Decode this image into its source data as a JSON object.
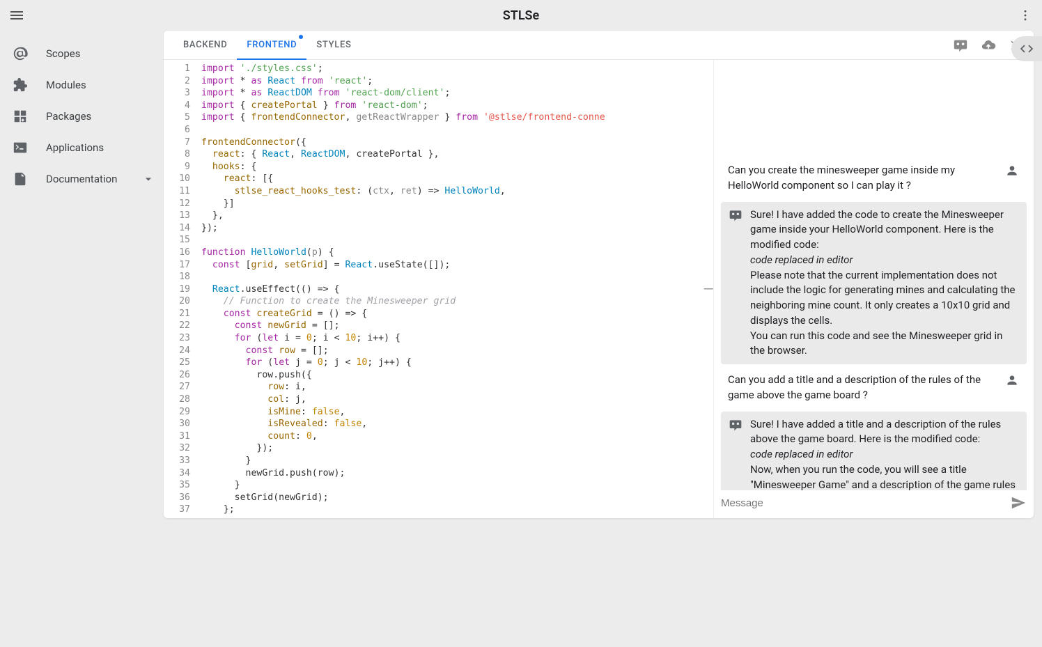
{
  "app": {
    "title": "STLSe"
  },
  "sidebar": {
    "items": [
      {
        "label": "Scopes"
      },
      {
        "label": "Modules"
      },
      {
        "label": "Packages"
      },
      {
        "label": "Applications"
      },
      {
        "label": "Documentation"
      }
    ]
  },
  "tabs": [
    {
      "label": "BACKEND"
    },
    {
      "label": "FRONTEND"
    },
    {
      "label": "STYLES"
    }
  ],
  "active_tab": 1,
  "editor": {
    "line_start": 1,
    "line_end": 37
  },
  "code_lines": [
    [
      {
        "t": "kw",
        "v": "import"
      },
      {
        "t": "",
        "v": " "
      },
      {
        "t": "str",
        "v": "'./styles.css'"
      },
      {
        "t": "",
        "v": ";"
      }
    ],
    [
      {
        "t": "kw",
        "v": "import"
      },
      {
        "t": "",
        "v": " * "
      },
      {
        "t": "kw",
        "v": "as"
      },
      {
        "t": "",
        "v": " "
      },
      {
        "t": "fn",
        "v": "React"
      },
      {
        "t": "",
        "v": " "
      },
      {
        "t": "kw",
        "v": "from"
      },
      {
        "t": "",
        "v": " "
      },
      {
        "t": "str",
        "v": "'react'"
      },
      {
        "t": "",
        "v": ";"
      }
    ],
    [
      {
        "t": "kw",
        "v": "import"
      },
      {
        "t": "",
        "v": " * "
      },
      {
        "t": "kw",
        "v": "as"
      },
      {
        "t": "",
        "v": " "
      },
      {
        "t": "fn",
        "v": "ReactDOM"
      },
      {
        "t": "",
        "v": " "
      },
      {
        "t": "kw",
        "v": "from"
      },
      {
        "t": "",
        "v": " "
      },
      {
        "t": "str",
        "v": "'react-dom/client'"
      },
      {
        "t": "",
        "v": ";"
      }
    ],
    [
      {
        "t": "kw",
        "v": "import"
      },
      {
        "t": "",
        "v": " { "
      },
      {
        "t": "id",
        "v": "createPortal"
      },
      {
        "t": "",
        "v": " } "
      },
      {
        "t": "kw",
        "v": "from"
      },
      {
        "t": "",
        "v": " "
      },
      {
        "t": "str",
        "v": "'react-dom'"
      },
      {
        "t": "",
        "v": ";"
      }
    ],
    [
      {
        "t": "kw",
        "v": "import"
      },
      {
        "t": "",
        "v": " { "
      },
      {
        "t": "id",
        "v": "frontendConnector"
      },
      {
        "t": "",
        "v": ", "
      },
      {
        "t": "ctx",
        "v": "getReactWrapper"
      },
      {
        "t": "",
        "v": " } "
      },
      {
        "t": "kw",
        "v": "from"
      },
      {
        "t": "",
        "v": " "
      },
      {
        "t": "red",
        "v": "'@stlse/frontend-conne"
      }
    ],
    [],
    [
      {
        "t": "id",
        "v": "frontendConnector"
      },
      {
        "t": "",
        "v": "({"
      }
    ],
    [
      {
        "t": "",
        "v": "  "
      },
      {
        "t": "id",
        "v": "react"
      },
      {
        "t": "",
        "v": ": { "
      },
      {
        "t": "fn",
        "v": "React"
      },
      {
        "t": "",
        "v": ", "
      },
      {
        "t": "fn",
        "v": "ReactDOM"
      },
      {
        "t": "",
        "v": ", createPortal },"
      }
    ],
    [
      {
        "t": "",
        "v": "  "
      },
      {
        "t": "id",
        "v": "hooks"
      },
      {
        "t": "",
        "v": ": {"
      }
    ],
    [
      {
        "t": "",
        "v": "    "
      },
      {
        "t": "id",
        "v": "react"
      },
      {
        "t": "",
        "v": ": [{"
      }
    ],
    [
      {
        "t": "",
        "v": "      "
      },
      {
        "t": "id",
        "v": "stlse_react_hooks_test"
      },
      {
        "t": "",
        "v": ": ("
      },
      {
        "t": "ctx",
        "v": "ctx"
      },
      {
        "t": "",
        "v": ", "
      },
      {
        "t": "ctx",
        "v": "ret"
      },
      {
        "t": "",
        "v": ") => "
      },
      {
        "t": "fn",
        "v": "HelloWorld"
      },
      {
        "t": "",
        "v": ","
      }
    ],
    [
      {
        "t": "",
        "v": "    }]"
      }
    ],
    [
      {
        "t": "",
        "v": "  },"
      }
    ],
    [
      {
        "t": "",
        "v": "});"
      }
    ],
    [],
    [
      {
        "t": "kw",
        "v": "function"
      },
      {
        "t": "",
        "v": " "
      },
      {
        "t": "fn",
        "v": "HelloWorld"
      },
      {
        "t": "",
        "v": "("
      },
      {
        "t": "ctx",
        "v": "p"
      },
      {
        "t": "",
        "v": ") {"
      }
    ],
    [
      {
        "t": "",
        "v": "  "
      },
      {
        "t": "kw",
        "v": "const"
      },
      {
        "t": "",
        "v": " ["
      },
      {
        "t": "id",
        "v": "grid"
      },
      {
        "t": "",
        "v": ", "
      },
      {
        "t": "id",
        "v": "setGrid"
      },
      {
        "t": "",
        "v": "] = "
      },
      {
        "t": "fn",
        "v": "React"
      },
      {
        "t": "",
        "v": ".useState([]);"
      }
    ],
    [],
    [
      {
        "t": "",
        "v": "  "
      },
      {
        "t": "fn",
        "v": "React"
      },
      {
        "t": "",
        "v": ".useEffect(() => {"
      }
    ],
    [
      {
        "t": "",
        "v": "    "
      },
      {
        "t": "cm",
        "v": "// Function to create the Minesweeper grid"
      }
    ],
    [
      {
        "t": "",
        "v": "    "
      },
      {
        "t": "kw",
        "v": "const"
      },
      {
        "t": "",
        "v": " "
      },
      {
        "t": "id",
        "v": "createGrid"
      },
      {
        "t": "",
        "v": " = () => {"
      }
    ],
    [
      {
        "t": "",
        "v": "      "
      },
      {
        "t": "kw",
        "v": "const"
      },
      {
        "t": "",
        "v": " "
      },
      {
        "t": "id",
        "v": "newGrid"
      },
      {
        "t": "",
        "v": " = [];"
      }
    ],
    [
      {
        "t": "",
        "v": "      "
      },
      {
        "t": "kw",
        "v": "for"
      },
      {
        "t": "",
        "v": " ("
      },
      {
        "t": "kw",
        "v": "let"
      },
      {
        "t": "",
        "v": " i = "
      },
      {
        "t": "num",
        "v": "0"
      },
      {
        "t": "",
        "v": "; i < "
      },
      {
        "t": "num",
        "v": "10"
      },
      {
        "t": "",
        "v": "; i++) {"
      }
    ],
    [
      {
        "t": "",
        "v": "        "
      },
      {
        "t": "kw",
        "v": "const"
      },
      {
        "t": "",
        "v": " "
      },
      {
        "t": "id",
        "v": "row"
      },
      {
        "t": "",
        "v": " = [];"
      }
    ],
    [
      {
        "t": "",
        "v": "        "
      },
      {
        "t": "kw",
        "v": "for"
      },
      {
        "t": "",
        "v": " ("
      },
      {
        "t": "kw",
        "v": "let"
      },
      {
        "t": "",
        "v": " j = "
      },
      {
        "t": "num",
        "v": "0"
      },
      {
        "t": "",
        "v": "; j < "
      },
      {
        "t": "num",
        "v": "10"
      },
      {
        "t": "",
        "v": "; j++) {"
      }
    ],
    [
      {
        "t": "",
        "v": "          row.push({"
      }
    ],
    [
      {
        "t": "",
        "v": "            "
      },
      {
        "t": "id",
        "v": "row"
      },
      {
        "t": "",
        "v": ": i,"
      }
    ],
    [
      {
        "t": "",
        "v": "            "
      },
      {
        "t": "id",
        "v": "col"
      },
      {
        "t": "",
        "v": ": j,"
      }
    ],
    [
      {
        "t": "",
        "v": "            "
      },
      {
        "t": "id",
        "v": "isMine"
      },
      {
        "t": "",
        "v": ": "
      },
      {
        "t": "bool",
        "v": "false"
      },
      {
        "t": "",
        "v": ","
      }
    ],
    [
      {
        "t": "",
        "v": "            "
      },
      {
        "t": "id",
        "v": "isRevealed"
      },
      {
        "t": "",
        "v": ": "
      },
      {
        "t": "bool",
        "v": "false"
      },
      {
        "t": "",
        "v": ","
      }
    ],
    [
      {
        "t": "",
        "v": "            "
      },
      {
        "t": "id",
        "v": "count"
      },
      {
        "t": "",
        "v": ": "
      },
      {
        "t": "num",
        "v": "0"
      },
      {
        "t": "",
        "v": ","
      }
    ],
    [
      {
        "t": "",
        "v": "          });"
      }
    ],
    [
      {
        "t": "",
        "v": "        }"
      }
    ],
    [
      {
        "t": "",
        "v": "        newGrid.push(row);"
      }
    ],
    [
      {
        "t": "",
        "v": "      }"
      }
    ],
    [
      {
        "t": "",
        "v": "      setGrid(newGrid);"
      }
    ],
    [
      {
        "t": "",
        "v": "    };"
      }
    ]
  ],
  "chat": {
    "messages": [
      {
        "role": "user",
        "text": "Can you create the minesweeper game inside my HelloWorld component so I can play it ?"
      },
      {
        "role": "bot",
        "parts": [
          "Sure! I have added the code to create the Minesweeper game inside your HelloWorld component. Here is the modified code:",
          {
            "em": "code replaced in editor"
          },
          "Please note that the current implementation does not include the logic for generating mines and calculating the neighboring mine count. It only creates a 10x10 grid and displays the cells.",
          "You can run this code and see the Minesweeper grid in the browser."
        ]
      },
      {
        "role": "user",
        "text": "Can you add a title and a description of the rules of the game above the game board ?"
      },
      {
        "role": "bot",
        "parts": [
          "Sure! I have added a title and a description of the rules above the game board. Here is the modified code:",
          {
            "em": "code replaced in editor"
          },
          "Now, when you run the code, you will see a title \"Minesweeper Game\" and a description of the game rules above the game board."
        ]
      }
    ],
    "placeholder": "Message"
  }
}
